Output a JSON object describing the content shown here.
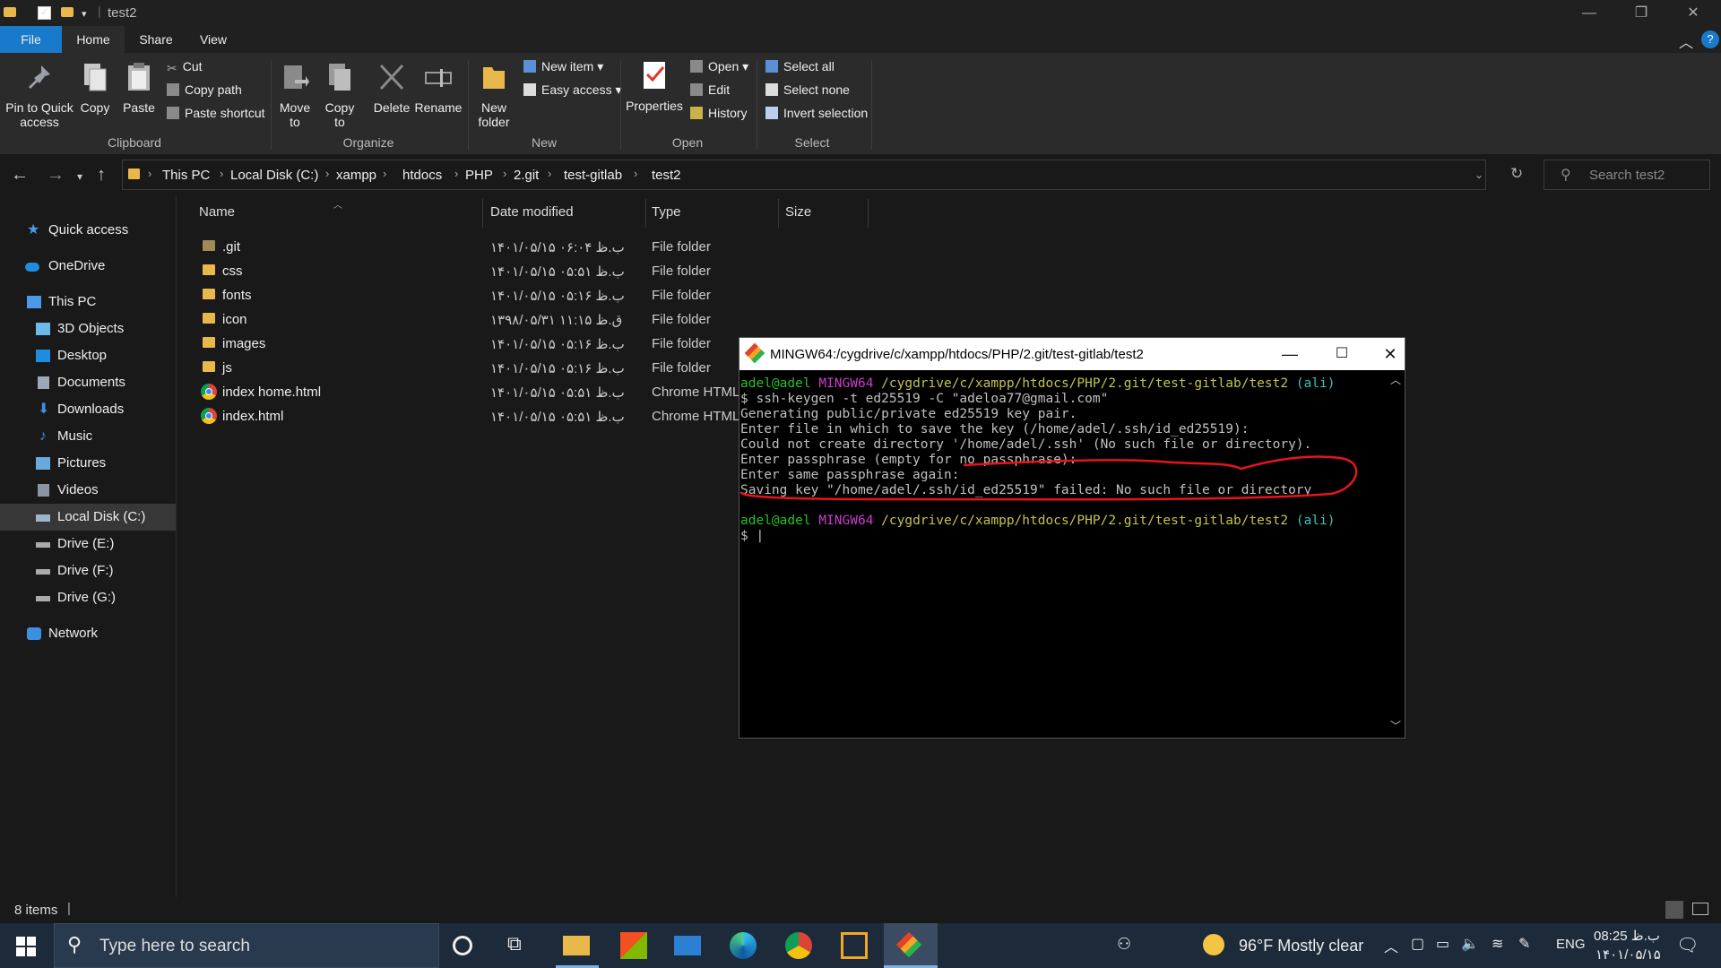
{
  "window": {
    "title": "test2",
    "controls": {
      "minimize": "—",
      "maximize": "❐",
      "close": "✕"
    }
  },
  "ribbon": {
    "tabs": [
      {
        "label": "File"
      },
      {
        "label": "Home"
      },
      {
        "label": "Share"
      },
      {
        "label": "View"
      }
    ],
    "clipboard": {
      "pin_l1": "Pin to Quick",
      "pin_l2": "access",
      "copy": "Copy",
      "paste": "Paste",
      "cut": "Cut",
      "copy_path": "Copy path",
      "paste_shortcut": "Paste shortcut",
      "group": "Clipboard"
    },
    "organize": {
      "move_l1": "Move",
      "move_l2": "to",
      "copyto_l1": "Copy",
      "copyto_l2": "to",
      "delete": "Delete",
      "rename": "Rename",
      "group": "Organize"
    },
    "new": {
      "folder_l1": "New",
      "folder_l2": "folder",
      "new_item": "New item",
      "easy_access": "Easy access",
      "group": "New"
    },
    "open": {
      "properties": "Properties",
      "open": "Open",
      "edit": "Edit",
      "history": "History",
      "group": "Open"
    },
    "select": {
      "select_all": "Select all",
      "select_none": "Select none",
      "invert": "Invert selection",
      "group": "Select"
    }
  },
  "address": {
    "crumbs": [
      "This PC",
      "Local Disk (C:)",
      "xampp",
      "htdocs",
      "PHP",
      "2.git",
      "test-gitlab",
      "test2"
    ],
    "search_placeholder": "Search test2"
  },
  "navpane": {
    "items": [
      "Quick access",
      "OneDrive",
      "This PC",
      "3D Objects",
      "Desktop",
      "Documents",
      "Downloads",
      "Music",
      "Pictures",
      "Videos",
      "Local Disk (C:)",
      "Drive (E:)",
      "Drive (F:)",
      "Drive (G:)",
      "Network"
    ]
  },
  "filelist": {
    "columns": {
      "name": "Name",
      "date": "Date modified",
      "type": "Type",
      "size": "Size"
    },
    "rows": [
      {
        "name": ".git",
        "date": "۱۴۰۱/۰۵/۱۵ ب.ظ ۰۶:۰۴",
        "type": "File folder"
      },
      {
        "name": "css",
        "date": "۱۴۰۱/۰۵/۱۵ ب.ظ ۰۵:۵۱",
        "type": "File folder"
      },
      {
        "name": "fonts",
        "date": "۱۴۰۱/۰۵/۱۵ ب.ظ ۰۵:۱۶",
        "type": "File folder"
      },
      {
        "name": "icon",
        "date": "۱۳۹۸/۰۵/۳۱ ق.ظ ۱۱:۱۵",
        "type": "File folder"
      },
      {
        "name": "images",
        "date": "۱۴۰۱/۰۵/۱۵ ب.ظ ۰۵:۱۶",
        "type": "File folder"
      },
      {
        "name": "js",
        "date": "۱۴۰۱/۰۵/۱۵ ب.ظ ۰۵:۱۶",
        "type": "File folder"
      },
      {
        "name": "index home.html",
        "date": "۱۴۰۱/۰۵/۱۵ ب.ظ ۰۵:۵۱",
        "type": "Chrome HTML"
      },
      {
        "name": "index.html",
        "date": "۱۴۰۱/۰۵/۱۵ ب.ظ ۰۵:۵۱",
        "type": "Chrome HTML"
      }
    ]
  },
  "status": {
    "items": "8 items"
  },
  "terminal": {
    "title": "MINGW64:/cygdrive/c/xampp/htdocs/PHP/2.git/test-gitlab/test2",
    "prompt_user": "adel@adel",
    "prompt_sys": "MINGW64",
    "prompt_path": "/cygdrive/c/xampp/htdocs/PHP/2.git/test-gitlab/test2",
    "prompt_branch": "(ali)",
    "lines": [
      "$ ssh-keygen -t ed25519 -C \"adeloa77@gmail.com\"",
      "Generating public/private ed25519 key pair.",
      "Enter file in which to save the key (/home/adel/.ssh/id_ed25519):",
      "Could not create directory '/home/adel/.ssh' (No such file or directory).",
      "Enter passphrase (empty for no passphrase):",
      "Enter same passphrase again:",
      "Saving key \"/home/adel/.ssh/id_ed25519\" failed: No such file or directory"
    ],
    "cursor_prompt": "$ |"
  },
  "taskbar": {
    "search_placeholder": "Type here to search",
    "weather": "96°F  Mostly clear",
    "lang": "ENG",
    "time": "08:25 ب.ظ",
    "date": "۱۴۰۱/۰۵/۱۵"
  },
  "colors": {
    "file_tab": "#1979ca",
    "term_user": "#27c127",
    "term_sys": "#c93ec9",
    "term_path": "#c3c34e",
    "term_branch": "#3fbfbf",
    "annotation": "#e8141c"
  }
}
